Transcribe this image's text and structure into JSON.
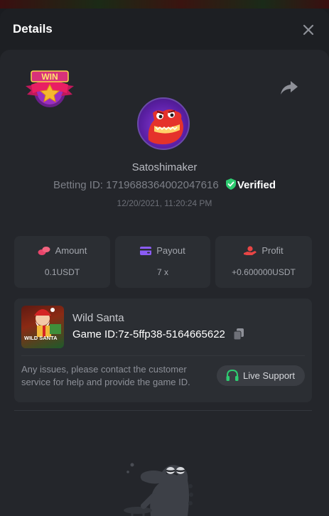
{
  "header": {
    "title": "Details"
  },
  "profile": {
    "badge_text": "WIN",
    "username": "Satoshimaker",
    "betting_id_label": "Betting ID:",
    "betting_id": "1719688364002047616",
    "verified_label": "Verified",
    "date": "12/20/2021, 11:20:24 PM"
  },
  "stats": [
    {
      "label": "Amount",
      "value": "0.1USDT",
      "icon": "coins-icon"
    },
    {
      "label": "Payout",
      "value": "7 x",
      "icon": "wallet-icon"
    },
    {
      "label": "Profit",
      "value": "+0.600000USDT",
      "icon": "hand-coin-icon"
    }
  ],
  "game": {
    "name": "Wild Santa",
    "id_label": "Game ID:",
    "id": "7z-5ffp38-5164665622",
    "thumb_text": "WILD SANTA"
  },
  "support": {
    "message": "Any issues, please contact the customer service for help and provide the game ID.",
    "button_label": "Live Support"
  },
  "colors": {
    "accent_green": "#2ecc71",
    "amount_icon": "#e8456b",
    "payout_icon": "#8b5cf6",
    "profit_icon": "#e84545",
    "badge_pink": "#d8327a",
    "badge_gold": "#f5b82e"
  }
}
